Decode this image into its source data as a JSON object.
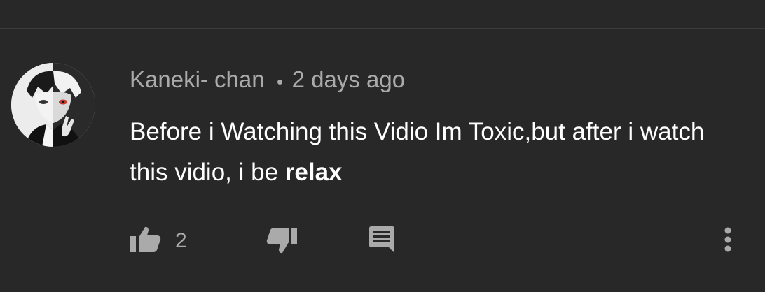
{
  "comment": {
    "author": "Kaneki- chan",
    "timestamp": "2 days ago",
    "text_part1": "Before i Watching this Vidio Im Toxic,but after i watch this vidio, i be ",
    "text_bold": "relax",
    "like_count": "2"
  },
  "icons": {
    "like": "thumb-up-icon",
    "dislike": "thumb-down-icon",
    "reply": "comment-icon",
    "menu": "more-vertical-icon"
  },
  "colors": {
    "background": "#282828",
    "secondary_text": "#aaaaaa",
    "primary_text": "#ffffff"
  }
}
